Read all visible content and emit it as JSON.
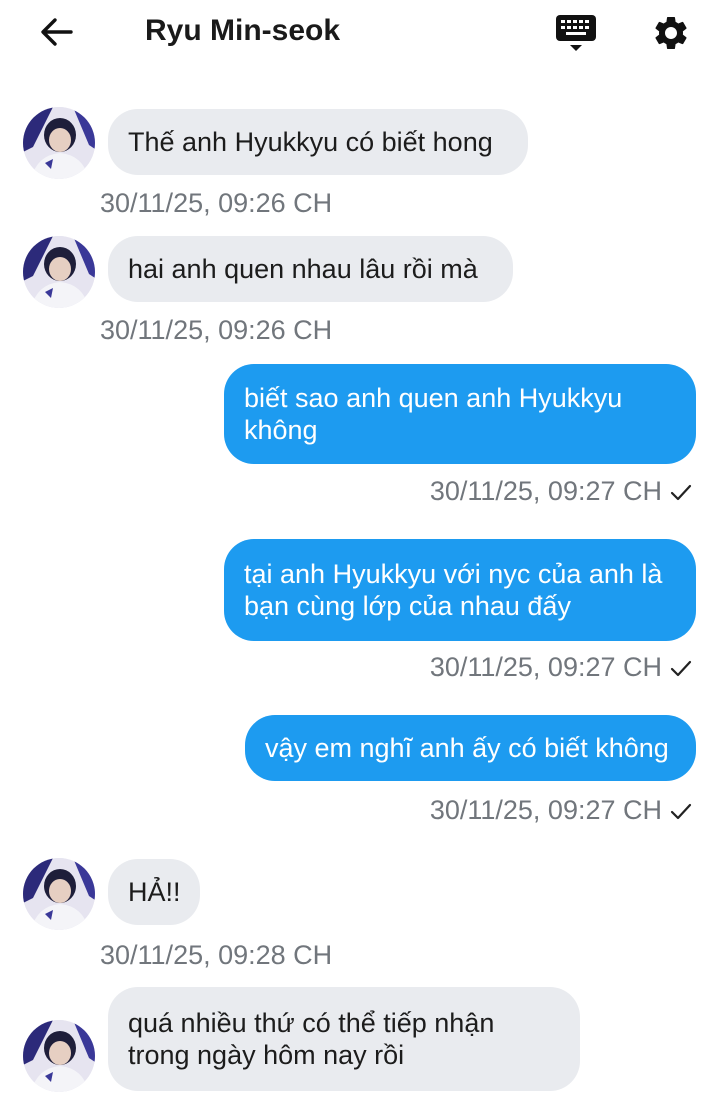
{
  "header": {
    "contact_name": "Ryu Min-seok",
    "back_icon": "arrow-left-icon",
    "keyboard_icon": "keyboard-icon",
    "settings_icon": "gear-icon"
  },
  "messages": [
    {
      "direction": "in",
      "text": "Thế anh Hyukkyu có biết hong",
      "time": "30/11/25, 09:26 CH"
    },
    {
      "direction": "in",
      "text": "hai anh quen nhau lâu rồi mà",
      "time": "30/11/25, 09:26 CH"
    },
    {
      "direction": "out",
      "lines": [
        "biết sao anh quen anh Hyukkyu",
        "không"
      ],
      "time": "30/11/25, 09:27 CH",
      "status": "sent"
    },
    {
      "direction": "out",
      "lines": [
        "tại anh Hyukkyu với nyc của anh là",
        "bạn cùng lớp của nhau đấy"
      ],
      "time": "30/11/25, 09:27 CH",
      "status": "sent"
    },
    {
      "direction": "out",
      "text": "vậy em nghĩ anh ấy có biết không",
      "time": "30/11/25, 09:27 CH",
      "status": "sent"
    },
    {
      "direction": "in",
      "text": "HẢ!!",
      "time": "30/11/25, 09:28 CH"
    },
    {
      "direction": "in",
      "lines": [
        "quá nhiều thứ có thể tiếp nhận",
        "trong ngày hôm nay rồi"
      ]
    }
  ],
  "colors": {
    "outgoing_bubble": "#1d9bf0",
    "incoming_bubble": "#e9ebef",
    "timestamp": "#71767c"
  }
}
